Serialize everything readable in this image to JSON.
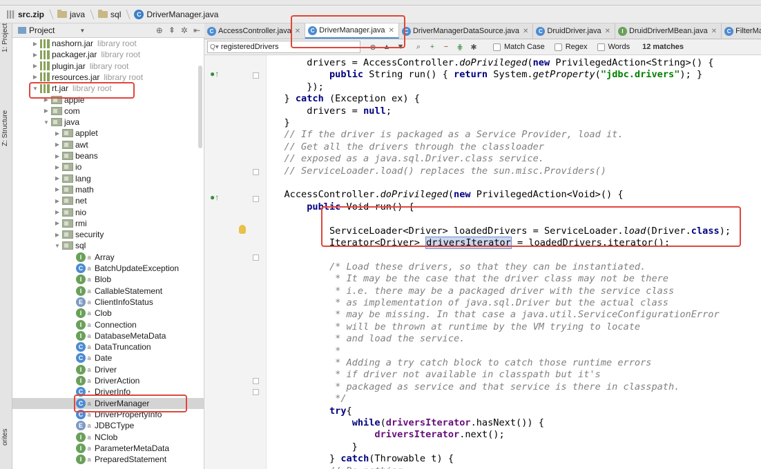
{
  "breadcrumb": {
    "items": [
      {
        "label": "src.zip",
        "icon": "zip-icon"
      },
      {
        "label": "java",
        "icon": "folder-icon"
      },
      {
        "label": "sql",
        "icon": "folder-icon"
      },
      {
        "label": "DriverManager.java",
        "icon": "class-icon"
      }
    ]
  },
  "sidebar_strip": {
    "project_tab": "1: Project",
    "structure_tab": "Z: Structure",
    "favorites_tab": "orites"
  },
  "project_panel": {
    "title": "Project",
    "tree": [
      {
        "label": "nashorn.jar",
        "suffix": "library root",
        "type": "lib",
        "indent": 0,
        "expanded": false
      },
      {
        "label": "packager.jar",
        "suffix": "library root",
        "type": "lib",
        "indent": 0,
        "expanded": false
      },
      {
        "label": "plugin.jar",
        "suffix": "library root",
        "type": "lib",
        "indent": 0,
        "expanded": false
      },
      {
        "label": "resources.jar",
        "suffix": "library root",
        "type": "lib",
        "indent": 0,
        "expanded": false
      },
      {
        "label": "rt.jar",
        "suffix": "library root",
        "type": "lib",
        "indent": 0,
        "expanded": true
      },
      {
        "label": "apple",
        "type": "pkg",
        "indent": 1,
        "expanded": false
      },
      {
        "label": "com",
        "type": "pkg",
        "indent": 1,
        "expanded": false
      },
      {
        "label": "java",
        "type": "pkg",
        "indent": 1,
        "expanded": true
      },
      {
        "label": "applet",
        "type": "pkg",
        "indent": 2,
        "expanded": false
      },
      {
        "label": "awt",
        "type": "pkg",
        "indent": 2,
        "expanded": false
      },
      {
        "label": "beans",
        "type": "pkg",
        "indent": 2,
        "expanded": false
      },
      {
        "label": "io",
        "type": "pkg",
        "indent": 2,
        "expanded": false
      },
      {
        "label": "lang",
        "type": "pkg",
        "indent": 2,
        "expanded": false
      },
      {
        "label": "math",
        "type": "pkg",
        "indent": 2,
        "expanded": false
      },
      {
        "label": "net",
        "type": "pkg",
        "indent": 2,
        "expanded": false
      },
      {
        "label": "nio",
        "type": "pkg",
        "indent": 2,
        "expanded": false
      },
      {
        "label": "rmi",
        "type": "pkg",
        "indent": 2,
        "expanded": false
      },
      {
        "label": "security",
        "type": "pkg",
        "indent": 2,
        "expanded": false
      },
      {
        "label": "sql",
        "type": "pkg",
        "indent": 2,
        "expanded": true
      },
      {
        "label": "Array",
        "type": "iface",
        "indent": 3
      },
      {
        "label": "BatchUpdateException",
        "type": "class",
        "indent": 3
      },
      {
        "label": "Blob",
        "type": "iface",
        "indent": 3
      },
      {
        "label": "CallableStatement",
        "type": "iface",
        "indent": 3
      },
      {
        "label": "ClientInfoStatus",
        "type": "enum",
        "indent": 3
      },
      {
        "label": "Clob",
        "type": "iface",
        "indent": 3
      },
      {
        "label": "Connection",
        "type": "iface",
        "indent": 3
      },
      {
        "label": "DatabaseMetaData",
        "type": "iface",
        "indent": 3
      },
      {
        "label": "DataTruncation",
        "type": "class",
        "indent": 3
      },
      {
        "label": "Date",
        "type": "class",
        "indent": 3
      },
      {
        "label": "Driver",
        "type": "iface",
        "indent": 3
      },
      {
        "label": "DriverAction",
        "type": "iface",
        "indent": 3
      },
      {
        "label": "DriverInfo",
        "type": "class",
        "indent": 3
      },
      {
        "label": "DriverManager",
        "type": "class",
        "indent": 3,
        "selected": true
      },
      {
        "label": "DriverPropertyInfo",
        "type": "class",
        "indent": 3
      },
      {
        "label": "JDBCType",
        "type": "enum",
        "indent": 3
      },
      {
        "label": "NClob",
        "type": "iface",
        "indent": 3
      },
      {
        "label": "ParameterMetaData",
        "type": "iface",
        "indent": 3
      },
      {
        "label": "PreparedStatement",
        "type": "iface",
        "indent": 3
      }
    ]
  },
  "editor_tabs": [
    {
      "label": "AccessController.java",
      "active": false,
      "icon": "class-icon"
    },
    {
      "label": "DriverManager.java",
      "active": true,
      "icon": "class-icon"
    },
    {
      "label": "DriverManagerDataSource.java",
      "active": false,
      "icon": "class-icon"
    },
    {
      "label": "DruidDriver.java",
      "active": false,
      "icon": "class-icon"
    },
    {
      "label": "DruidDriverMBean.java",
      "active": false,
      "icon": "interface-icon"
    },
    {
      "label": "FilterMana",
      "active": false,
      "icon": "class-icon"
    }
  ],
  "find_bar": {
    "query": "registeredDrivers",
    "match_case": "Match Case",
    "regex": "Regex",
    "words": "Words",
    "matches": "12 matches"
  },
  "code_lines": [
    "            drivers = AccessController.doPrivileged(new PrivilegedAction<String>() {",
    "                public String run() { return System.getProperty(\"jdbc.drivers\"); }",
    "            });",
    "        } catch (Exception ex) {",
    "            drivers = null;",
    "        }",
    "        // If the driver is packaged as a Service Provider, load it.",
    "        // Get all the drivers through the classloader",
    "        // exposed as a java.sql.Driver.class service.",
    "        // ServiceLoader.load() replaces the sun.misc.Providers()",
    "",
    "        AccessController.doPrivileged(new PrivilegedAction<Void>() {",
    "            public Void run() {",
    "",
    "                ServiceLoader<Driver> loadedDrivers = ServiceLoader.load(Driver.class);",
    "                Iterator<Driver> driversIterator = loadedDrivers.iterator();",
    "",
    "                /* Load these drivers, so that they can be instantiated.",
    "                 * It may be the case that the driver class may not be there",
    "                 * i.e. there may be a packaged driver with the service class",
    "                 * as implementation of java.sql.Driver but the actual class",
    "                 * may be missing. In that case a java.util.ServiceConfigurationError",
    "                 * will be thrown at runtime by the VM trying to locate",
    "                 * and load the service.",
    "                 *",
    "                 * Adding a try catch block to catch those runtime errors",
    "                 * if driver not available in classpath but it's",
    "                 * packaged as service and that service is there in classpath.",
    "                 */",
    "                try{",
    "                    while(driversIterator.hasNext()) {",
    "                        driversIterator.next();",
    "                    }",
    "                } catch(Throwable t) {",
    "                // Do nothing",
    "                }"
  ],
  "colors": {
    "keyword": "#000080",
    "string": "#008000",
    "comment": "#808080",
    "annotation_box": "#e0453a",
    "selection": "#ccd7ee"
  }
}
